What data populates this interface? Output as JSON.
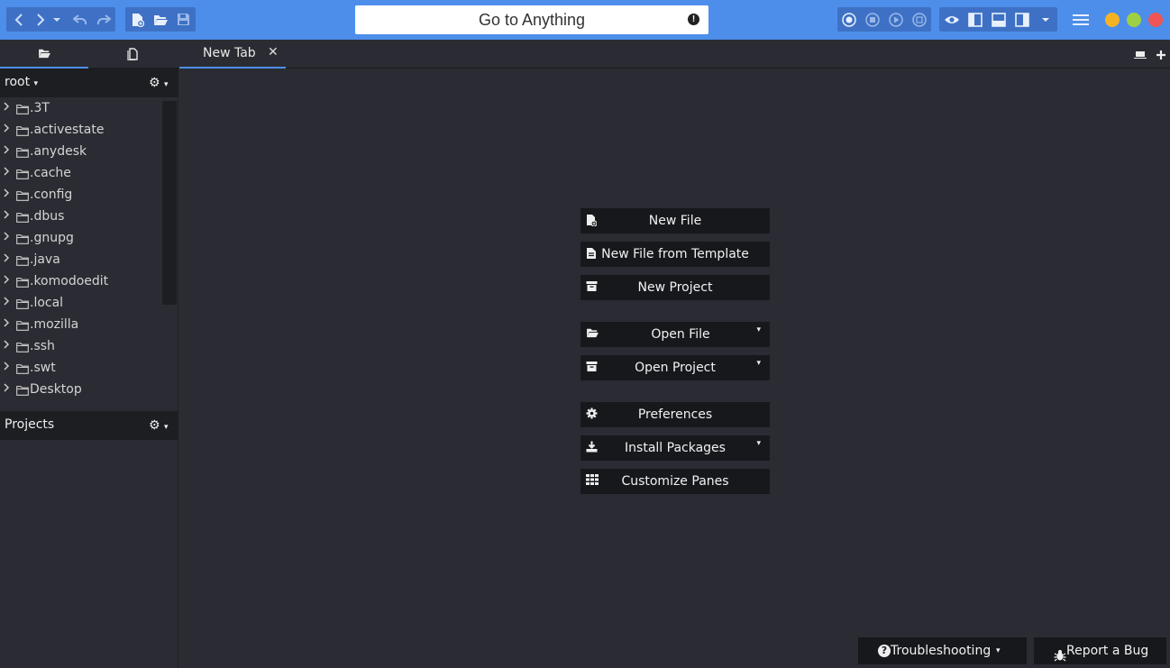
{
  "toolbar": {
    "goto_label": "Go to Anything",
    "goto_warning": "!"
  },
  "tabs": {
    "active_label": "New Tab",
    "close_glyph": "✕"
  },
  "places": {
    "root_label": "root",
    "dropdown_glyph": "▾",
    "gear_glyph": "⚙",
    "items": [
      ".3T",
      ".activestate",
      ".anydesk",
      ".cache",
      ".config",
      ".dbus",
      ".gnupg",
      ".java",
      ".komodoedit",
      ".local",
      ".mozilla",
      ".ssh",
      ".swt",
      "Desktop"
    ]
  },
  "projects": {
    "label": "Projects"
  },
  "start": {
    "new_file": "New File",
    "new_file_template": "New File from Template",
    "new_project": "New Project",
    "open_file": "Open File",
    "open_project": "Open Project",
    "preferences": "Preferences",
    "install_packages": "Install Packages",
    "customize_panes": "Customize Panes",
    "caret": "▾"
  },
  "bottom": {
    "troubleshooting": "Troubleshooting",
    "report_bug": "Report a Bug"
  },
  "colors": {
    "toolbar_bg": "#4d8eea",
    "window_min": "#f5b324",
    "window_max": "#9fd043",
    "window_close": "#f05454"
  }
}
